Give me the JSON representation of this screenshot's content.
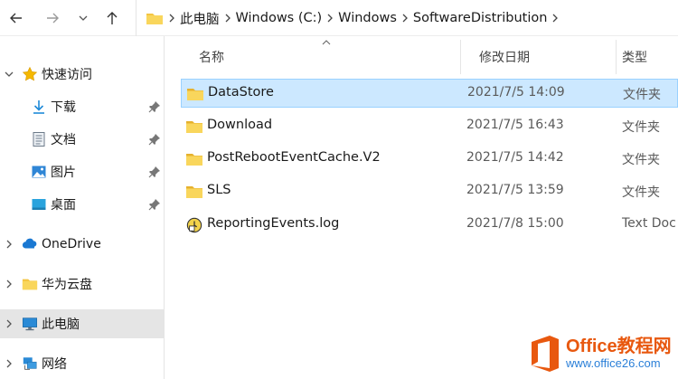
{
  "toolbar": {
    "back": "back-arrow-icon",
    "forward": "forward-arrow-icon",
    "recent": "chevron-down-icon",
    "up": "up-arrow-icon"
  },
  "breadcrumb": [
    "此电脑",
    "Windows (C:)",
    "Windows",
    "SoftwareDistribution"
  ],
  "nav": {
    "quick_access": "快速访问",
    "downloads": "下载",
    "documents": "文档",
    "pictures": "图片",
    "desktop": "桌面",
    "onedrive": "OneDrive",
    "huawei_cloud": "华为云盘",
    "this_pc": "此电脑",
    "network": "网络"
  },
  "columns": {
    "name": "名称",
    "modified": "修改日期",
    "type": "类型"
  },
  "files": [
    {
      "name": "DataStore",
      "modified": "2021/7/5 14:09",
      "type": "文件夹",
      "icon": "folder-icon"
    },
    {
      "name": "Download",
      "modified": "2021/7/5 16:43",
      "type": "文件夹",
      "icon": "folder-icon"
    },
    {
      "name": "PostRebootEventCache.V2",
      "modified": "2021/7/5 14:42",
      "type": "文件夹",
      "icon": "folder-icon"
    },
    {
      "name": "SLS",
      "modified": "2021/7/5 13:59",
      "type": "文件夹",
      "icon": "folder-icon"
    },
    {
      "name": "ReportingEvents.log",
      "modified": "2021/7/8 15:00",
      "type": "Text Doc",
      "icon": "log-file-icon"
    }
  ],
  "watermark": {
    "line1": "Office教程网",
    "line2": "www.office26.com"
  },
  "colors": {
    "selection": "#cce8ff",
    "selection_border": "#99d1ff",
    "folder": "#f4c542",
    "nav_selected": "#e5e5e5"
  }
}
